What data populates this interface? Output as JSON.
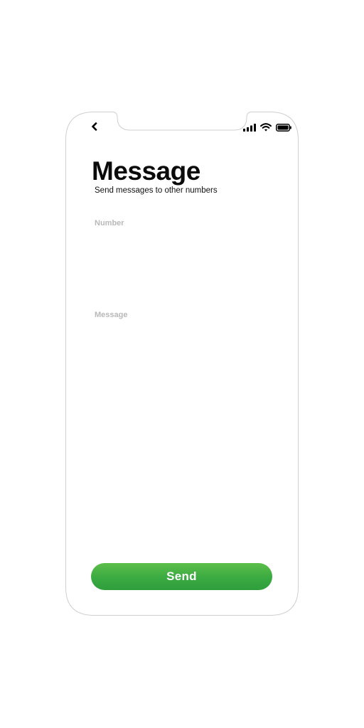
{
  "header": {
    "back_icon": "chevron-left-icon",
    "status_icons": [
      "signal-icon",
      "wifi-icon",
      "battery-icon"
    ]
  },
  "page": {
    "title": "Message",
    "subtitle": "Send messages to other numbers"
  },
  "form": {
    "number": {
      "label": "Number",
      "value": ""
    },
    "message": {
      "label": "Message",
      "value": ""
    },
    "send_label": "Send"
  },
  "colors": {
    "accent": "#3aaa42",
    "accent_light": "#5cbf4a",
    "label_gray": "#b9b9b9",
    "outline_gray": "#cfcfcf",
    "text": "#0b0b0b"
  }
}
